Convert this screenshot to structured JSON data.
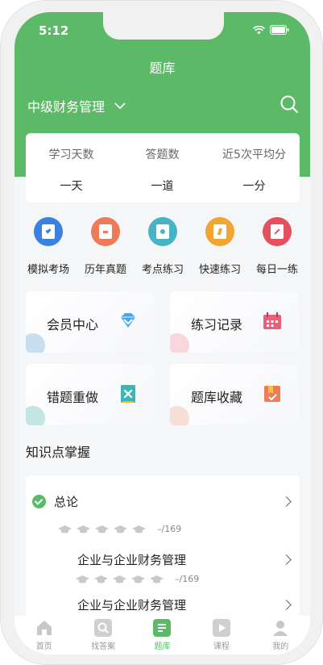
{
  "status": {
    "time": "5:12"
  },
  "header": {
    "title": "题库",
    "subject": "中级财务管理"
  },
  "stats": [
    {
      "label": "学习天数",
      "value": "一天"
    },
    {
      "label": "答题数",
      "value": "一道"
    },
    {
      "label": "近5次平均分",
      "value": "一分"
    }
  ],
  "quick_entries": [
    {
      "label": "模拟考场",
      "color": "#3b82e0",
      "icon": "exam-icon"
    },
    {
      "label": "历年真题",
      "color": "#ee7a58",
      "icon": "past-paper-icon"
    },
    {
      "label": "考点练习",
      "color": "#46b3c7",
      "icon": "key-point-icon"
    },
    {
      "label": "快速练习",
      "color": "#f2a532",
      "icon": "lightning-icon"
    },
    {
      "label": "每日一练",
      "color": "#e4505e",
      "icon": "daily-pencil-icon"
    }
  ],
  "features": [
    {
      "label": "会员中心",
      "icon": "diamond-icon"
    },
    {
      "label": "练习记录",
      "icon": "calendar-icon"
    },
    {
      "label": "错题重做",
      "icon": "wrong-book-icon"
    },
    {
      "label": "题库收藏",
      "icon": "collection-icon"
    }
  ],
  "knowledge": {
    "title": "知识点掌握",
    "chapter": {
      "name": "总论",
      "progress": "–/169"
    },
    "lessons": [
      {
        "name": "企业与企业财务管理",
        "progress": "–/169"
      },
      {
        "name": "企业与企业财务管理"
      }
    ]
  },
  "tabbar": [
    {
      "label": "首页",
      "icon": "home-icon"
    },
    {
      "label": "找答案",
      "icon": "search-answer-icon"
    },
    {
      "label": "题库",
      "icon": "question-bank-icon",
      "active": true
    },
    {
      "label": "课程",
      "icon": "video-course-icon"
    },
    {
      "label": "我的",
      "icon": "profile-icon"
    }
  ],
  "colors": {
    "brand_green": "#5cb967"
  }
}
